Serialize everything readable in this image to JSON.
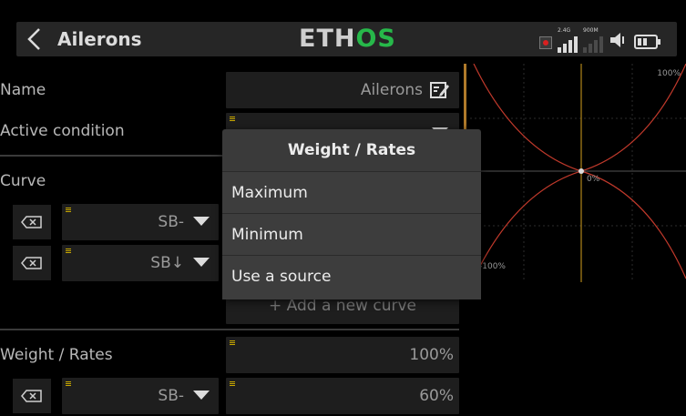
{
  "header": {
    "back_icon": "chevron-left-icon",
    "title": "Ailerons",
    "logo_part1": "ETH",
    "logo_part2": "OS",
    "logo_color_main": "#cfcfcf",
    "logo_color_accent": "#27b84a",
    "signal1_label": "2.4G",
    "signal2_label": "900M"
  },
  "form": {
    "name_label": "Name",
    "name_value": "Ailerons",
    "active_condition_label": "Active condition",
    "curve_label": "Curve",
    "curve_row1_source": "SB-",
    "curve_row2_source": "SB↓",
    "add_curve_label": "+ Add a new curve",
    "weight_label": "Weight / Rates",
    "weight_value": "100%",
    "weight_row_source": "SB-",
    "weight_row_value": "60%"
  },
  "graph": {
    "top_label": "100%",
    "center_label": "0%",
    "bottom_label": "-100%"
  },
  "popup": {
    "title": "Weight / Rates",
    "items": [
      "Maximum",
      "Minimum",
      "Use a source"
    ]
  },
  "colors": {
    "accent_yellow": "#c8a800",
    "curve_red": "#c0392b",
    "graph_axis": "#d4a01e",
    "divider_orange": "#b07a2a"
  }
}
